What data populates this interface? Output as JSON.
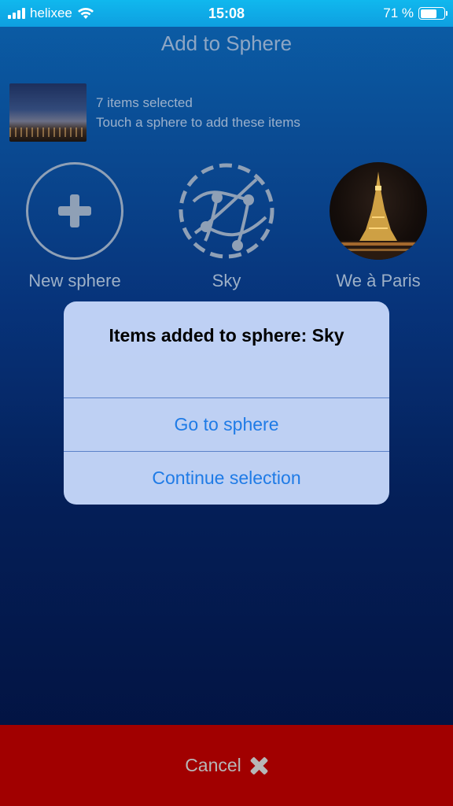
{
  "status_bar": {
    "carrier": "helixee",
    "time": "15:08",
    "battery_percent": "71 %",
    "battery_level": 0.71
  },
  "header": {
    "title": "Add to Sphere"
  },
  "selection": {
    "count_text": "7 items selected",
    "hint_text": "Touch a sphere to add these items"
  },
  "spheres": [
    {
      "label": "New sphere",
      "icon": "plus-icon"
    },
    {
      "label": "Sky",
      "icon": "network-sphere-icon"
    },
    {
      "label": "We à Paris",
      "icon": "eiffel-tower-photo"
    }
  ],
  "dialog": {
    "title": "Items added to sphere: Sky",
    "buttons": [
      "Go to sphere",
      "Continue selection"
    ]
  },
  "footer": {
    "cancel_label": "Cancel",
    "icon": "close-icon"
  },
  "colors": {
    "status_bar": "#0fb0ea",
    "dialog_button_text": "#1f7be6",
    "cancel_bar": "#a10000"
  }
}
